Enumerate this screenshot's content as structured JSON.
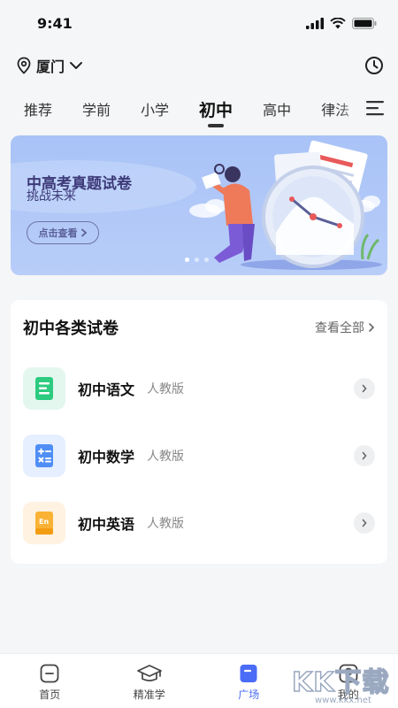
{
  "status_bar": {
    "time": "9:41"
  },
  "location": {
    "city": "厦门"
  },
  "tabs": [
    {
      "label": "推荐"
    },
    {
      "label": "学前"
    },
    {
      "label": "小学"
    },
    {
      "label": "初中",
      "active": true
    },
    {
      "label": "高中"
    },
    {
      "label": "律法"
    }
  ],
  "banner": {
    "title": "中高考真题试卷",
    "subtitle": "挑战未来",
    "button_label": "点击查看",
    "slides": 3,
    "active_slide": 1
  },
  "section": {
    "title": "初中各类试卷",
    "view_all": "查看全部",
    "subjects": [
      {
        "name": "初中语文",
        "edition": "人教版",
        "icon": "chinese-book-icon",
        "color": "#e4f7ee",
        "accent": "#2ccb7f"
      },
      {
        "name": "初中数学",
        "edition": "人教版",
        "icon": "math-book-icon",
        "color": "#e6efff",
        "accent": "#4f8ef5"
      },
      {
        "name": "初中英语",
        "edition": "人教版",
        "icon": "english-book-icon",
        "color": "#fff2e0",
        "accent": "#f9b233"
      }
    ]
  },
  "bottom_nav": [
    {
      "label": "首页",
      "icon": "home-icon"
    },
    {
      "label": "精准学",
      "icon": "graduation-cap-icon"
    },
    {
      "label": "广场",
      "icon": "square-icon",
      "active": true
    },
    {
      "label": "我的",
      "icon": "profile-icon"
    }
  ],
  "watermark": {
    "text": "KK下载",
    "url": "www.kkx.net"
  },
  "colors": {
    "accent": "#4a6cf7",
    "banner": "#a9c3f7",
    "title_text": "#3d3a78"
  }
}
